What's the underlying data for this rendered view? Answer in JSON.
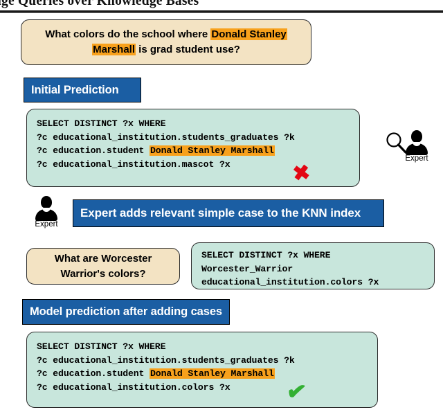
{
  "title": "nguage Queries over Knowledge Bases",
  "colors": {
    "banner_blue": "#1b5ea3",
    "question_cream": "#f3e3c3",
    "sql_mint": "#c8e6dc",
    "highlight_orange": "#f8a11c",
    "error_red": "#e30613",
    "success_green": "#33b033"
  },
  "question": {
    "line1_pre": "What colors do the school where ",
    "line1_hl": "Donald Stanley",
    "line2_hl": "Marshall",
    "line2_post": " is grad student use?"
  },
  "initial_prediction": {
    "banner_label": "Initial Prediction",
    "sql": {
      "line1": "SELECT DISTINCT ?x WHERE",
      "line2": "?c educational_institution.students_graduates ?k",
      "line3_pre": "?c education.student ",
      "line3_hl": "Donald Stanley Marshall",
      "line4": "?c educational_institution.mascot ?x"
    },
    "mark": "✖",
    "mark_name": "incorrect"
  },
  "expert_search": {
    "magnifier_icon": "search-icon",
    "person_icon": "person-icon",
    "label": "Expert"
  },
  "expert_action": {
    "person_icon": "person-icon",
    "label": "Expert",
    "banner_label": "Expert adds relevant simple case to the KNN index"
  },
  "added_case": {
    "question_line1": "What are Worcester",
    "question_line2": "Warrior's colors?",
    "sql": {
      "line1": "SELECT DISTINCT ?x WHERE",
      "line2": "Worcester_Warrior",
      "line3": "educational_institution.colors ?x"
    }
  },
  "final_prediction": {
    "banner_label": "Model prediction after adding cases",
    "sql": {
      "line1": "SELECT DISTINCT ?x WHERE",
      "line2": "?c educational_institution.students_graduates ?k",
      "line3_pre": "?c education.student ",
      "line3_hl": "Donald Stanley Marshall",
      "line4": "?c educational_institution.colors ?x"
    },
    "mark": "✔",
    "mark_name": "correct"
  }
}
